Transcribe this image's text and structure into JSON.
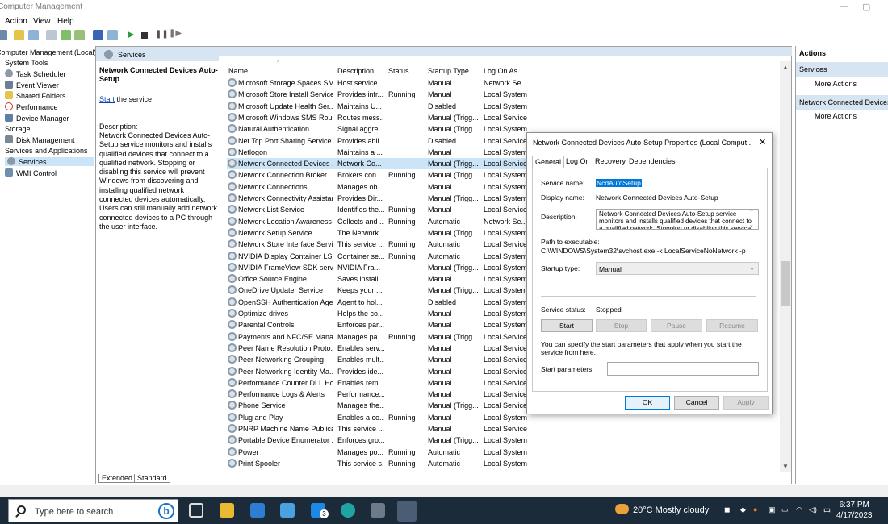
{
  "app": {
    "title": "Computer Management"
  },
  "menu": [
    "Action",
    "View",
    "Help"
  ],
  "tree": [
    {
      "label": "Computer Management (Local)"
    },
    {
      "label": "System Tools"
    },
    {
      "label": "Task Scheduler"
    },
    {
      "label": "Event Viewer"
    },
    {
      "label": "Shared Folders"
    },
    {
      "label": "Performance"
    },
    {
      "label": "Device Manager"
    },
    {
      "label": "Storage"
    },
    {
      "label": "Disk Management"
    },
    {
      "label": "Services and Applications"
    },
    {
      "label": "Services"
    },
    {
      "label": "WMI Control"
    }
  ],
  "main": {
    "header": "Services",
    "selected_title": "Network Connected Devices Auto-Setup",
    "start_link": "Start",
    "start_suffix": " the service",
    "desc_label": "Description:",
    "desc_text": "Network Connected Devices Auto-Setup service monitors and installs qualified devices that connect to a qualified network. Stopping or disabling this service will prevent Windows from discovering and installing qualified network connected devices automatically. Users can still manually add network connected devices to a PC through the user interface.",
    "columns": [
      "Name",
      "Description",
      "Status",
      "Startup Type",
      "Log On As"
    ],
    "rows": [
      [
        "Microsoft Storage Spaces SMP",
        "Host service ...",
        "",
        "Manual",
        "Network Se..."
      ],
      [
        "Microsoft Store Install Service",
        "Provides infr...",
        "Running",
        "Manual",
        "Local System"
      ],
      [
        "Microsoft Update Health Ser...",
        "Maintains U...",
        "",
        "Disabled",
        "Local System"
      ],
      [
        "Microsoft Windows SMS Rou...",
        "Routes mess...",
        "",
        "Manual (Trigg...",
        "Local Service"
      ],
      [
        "Natural Authentication",
        "Signal aggre...",
        "",
        "Manual (Trigg...",
        "Local System"
      ],
      [
        "Net.Tcp Port Sharing Service",
        "Provides abil...",
        "",
        "Disabled",
        "Local Service"
      ],
      [
        "Netlogon",
        "Maintains a ...",
        "",
        "Manual",
        "Local System"
      ],
      [
        "Network Connected Devices ...",
        "Network Co...",
        "",
        "Manual (Trigg...",
        "Local Service"
      ],
      [
        "Network Connection Broker",
        "Brokers con...",
        "Running",
        "Manual (Trigg...",
        "Local System"
      ],
      [
        "Network Connections",
        "Manages ob...",
        "",
        "Manual",
        "Local System"
      ],
      [
        "Network Connectivity Assistant",
        "Provides Dir...",
        "",
        "Manual (Trigg...",
        "Local System"
      ],
      [
        "Network List Service",
        "Identifies the...",
        "Running",
        "Manual",
        "Local Service"
      ],
      [
        "Network Location Awareness",
        "Collects and ...",
        "Running",
        "Automatic",
        "Network Se..."
      ],
      [
        "Network Setup Service",
        "The Network...",
        "",
        "Manual (Trigg...",
        "Local System"
      ],
      [
        "Network Store Interface Servi...",
        "This service ...",
        "Running",
        "Automatic",
        "Local Service"
      ],
      [
        "NVIDIA Display Container LS",
        "Container se...",
        "Running",
        "Automatic",
        "Local System"
      ],
      [
        "NVIDIA FrameView SDK servi...",
        "NVIDIA Fra...",
        "",
        "Manual (Trigg...",
        "Local System"
      ],
      [
        "Office  Source Engine",
        "Saves install...",
        "",
        "Manual",
        "Local System"
      ],
      [
        "OneDrive Updater Service",
        "Keeps your ...",
        "",
        "Manual (Trigg...",
        "Local System"
      ],
      [
        "OpenSSH Authentication Age...",
        "Agent to hol...",
        "",
        "Disabled",
        "Local System"
      ],
      [
        "Optimize drives",
        "Helps the co...",
        "",
        "Manual",
        "Local System"
      ],
      [
        "Parental Controls",
        "Enforces par...",
        "",
        "Manual",
        "Local System"
      ],
      [
        "Payments and NFC/SE Mana...",
        "Manages pa...",
        "Running",
        "Manual (Trigg...",
        "Local Service"
      ],
      [
        "Peer Name Resolution Proto...",
        "Enables serv...",
        "",
        "Manual",
        "Local Service"
      ],
      [
        "Peer Networking Grouping",
        "Enables mult...",
        "",
        "Manual",
        "Local Service"
      ],
      [
        "Peer Networking Identity Ma...",
        "Provides ide...",
        "",
        "Manual",
        "Local Service"
      ],
      [
        "Performance Counter DLL Host",
        "Enables rem...",
        "",
        "Manual",
        "Local Service"
      ],
      [
        "Performance Logs & Alerts",
        "Performance...",
        "",
        "Manual",
        "Local Service"
      ],
      [
        "Phone Service",
        "Manages the...",
        "",
        "Manual (Trigg...",
        "Local Service"
      ],
      [
        "Plug and Play",
        "Enables a co...",
        "Running",
        "Manual",
        "Local System"
      ],
      [
        "PNRP Machine Name Publica...",
        "This service ...",
        "",
        "Manual",
        "Local Service"
      ],
      [
        "Portable Device Enumerator ...",
        "Enforces gro...",
        "",
        "Manual (Trigg...",
        "Local System"
      ],
      [
        "Power",
        "Manages po...",
        "Running",
        "Automatic",
        "Local System"
      ],
      [
        "Print Spooler",
        "This service s...",
        "Running",
        "Automatic",
        "Local System"
      ]
    ],
    "bottom_tabs": [
      "Extended",
      "Standard"
    ]
  },
  "actions": {
    "header": "Actions",
    "section1": "Services",
    "more1": "More Actions",
    "section2": "Network Connected Devices ...",
    "more2": "More Actions"
  },
  "dialog": {
    "title": "Network Connected Devices Auto-Setup Properties (Local Comput...",
    "tabs": [
      "General",
      "Log On",
      "Recovery",
      "Dependencies"
    ],
    "service_name_label": "Service name:",
    "service_name": "NcdAutoSetup",
    "display_name_label": "Display name:",
    "display_name": "Network Connected Devices Auto-Setup",
    "description_label": "Description:",
    "description": "Network Connected Devices Auto-Setup service monitors and installs qualified devices that connect to a qualified network. Stopping or disabling this service",
    "path_label": "Path to executable:",
    "path": "C:\\WINDOWS\\System32\\svchost.exe -k LocalServiceNoNetwork -p",
    "startup_type_label": "Startup type:",
    "startup_type": "Manual",
    "status_label": "Service status:",
    "status": "Stopped",
    "btn_start": "Start",
    "btn_stop": "Stop",
    "btn_pause": "Pause",
    "btn_resume": "Resume",
    "params_note": "You can specify the start parameters that apply when you start the service from here.",
    "params_label": "Start parameters:",
    "ok": "OK",
    "cancel": "Cancel",
    "apply": "Apply"
  },
  "taskbar": {
    "search_placeholder": "Type here to search",
    "mail_badge": "3",
    "weather": "20°C  Mostly cloudy",
    "time": "6:37 PM",
    "date": "4/17/2023"
  }
}
